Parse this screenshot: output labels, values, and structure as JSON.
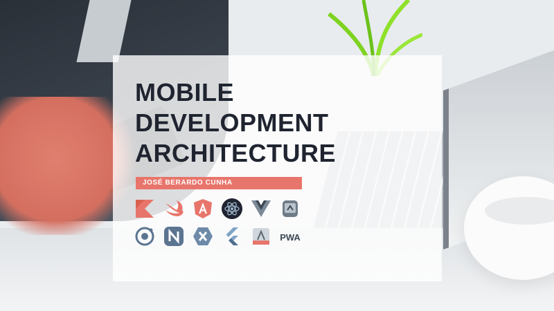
{
  "slide": {
    "title_lines": [
      "MOBILE",
      "DEVELOPMENT",
      "ARCHITECTURE"
    ],
    "author": "JOSÉ BERARDO CUNHA",
    "accent_color": "#e8756b",
    "title_color": "#1f2430"
  },
  "icons": {
    "row1": [
      "kotlin-icon",
      "swift-icon",
      "angular-icon",
      "react-icon",
      "vue-icon",
      "xcode-icon"
    ],
    "row2": [
      "ionic-icon",
      "nativescript-icon",
      "xamarin-icon",
      "flutter-icon",
      "android-studio-icon",
      "pwa-icon"
    ]
  },
  "pwa_label": "PWA"
}
